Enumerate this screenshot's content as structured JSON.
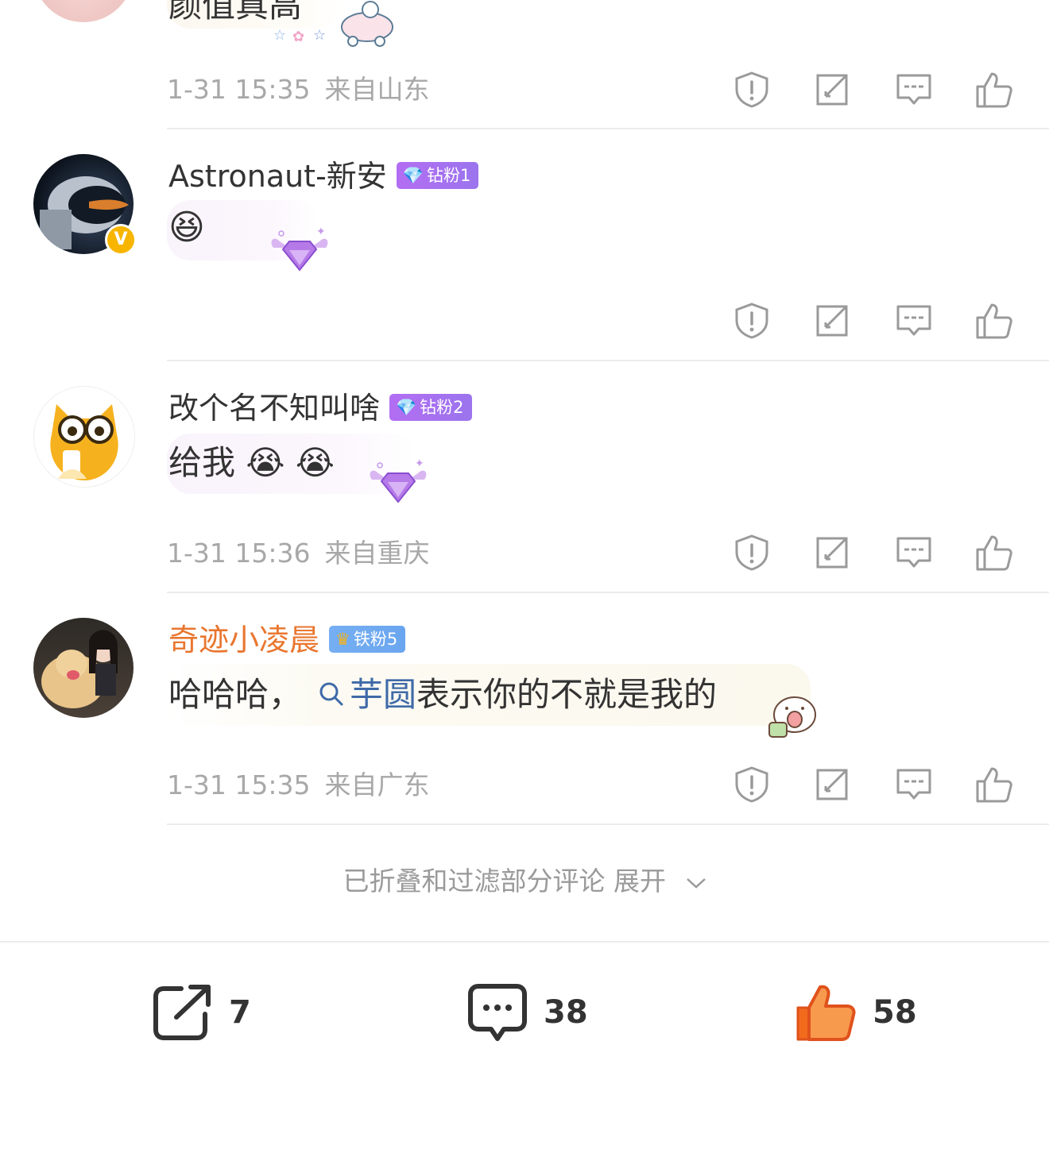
{
  "comments": [
    {
      "text": "颜值真高",
      "time": "1-31 15:35",
      "location": "来自山东"
    },
    {
      "username": "Astronaut-新安",
      "badge": "钻粉1",
      "emoji": "😆",
      "verified_mark": "V"
    },
    {
      "username": "改个名不知叫啥",
      "badge": "钻粉2",
      "text": "给我",
      "emojis": [
        "😭",
        "😭"
      ],
      "time": "1-31 15:36",
      "location": "来自重庆"
    },
    {
      "username": "奇迹小凌晨",
      "badge": "铁粉5",
      "text_before": "哈哈哈，",
      "link_text": "芋圆",
      "text_after": "表示你的不就是我的",
      "time": "1-31 15:35",
      "location": "来自广东"
    }
  ],
  "folded_notice": "已折叠和过滤部分评论 展开",
  "bottom_bar": {
    "repost_count": "7",
    "comment_count": "38",
    "like_count": "58"
  },
  "colors": {
    "username_highlight": "#e9762f",
    "like_active": "#f26b1d",
    "diamond_badge": "#b36ef2",
    "iron_badge": "#76aef2",
    "meta_gray": "#a8a8a8"
  }
}
